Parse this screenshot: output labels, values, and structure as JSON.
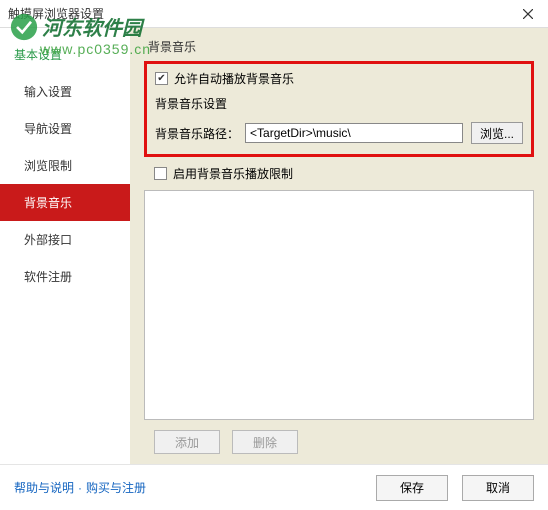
{
  "window": {
    "title": "触摸屏浏览器设置"
  },
  "watermark": {
    "name": "河东软件园",
    "url": "www.pc0359.cn"
  },
  "sidebar": {
    "header": "基本设置",
    "items": [
      {
        "label": "输入设置"
      },
      {
        "label": "导航设置"
      },
      {
        "label": "浏览限制"
      },
      {
        "label": "背景音乐"
      },
      {
        "label": "外部接口"
      },
      {
        "label": "软件注册"
      }
    ]
  },
  "main": {
    "section_title": "背景音乐",
    "allow_auto_play": "允许自动播放背景音乐",
    "settings_title": "背景音乐设置",
    "path_label": "背景音乐路径：",
    "path_value": "<TargetDir>\\music\\",
    "browse": "浏览...",
    "enable_limit": "启用背景音乐播放限制",
    "add": "添加",
    "delete": "删除"
  },
  "footer": {
    "help": "帮助与说明",
    "buy": "购买与注册",
    "save": "保存",
    "cancel": "取消"
  }
}
